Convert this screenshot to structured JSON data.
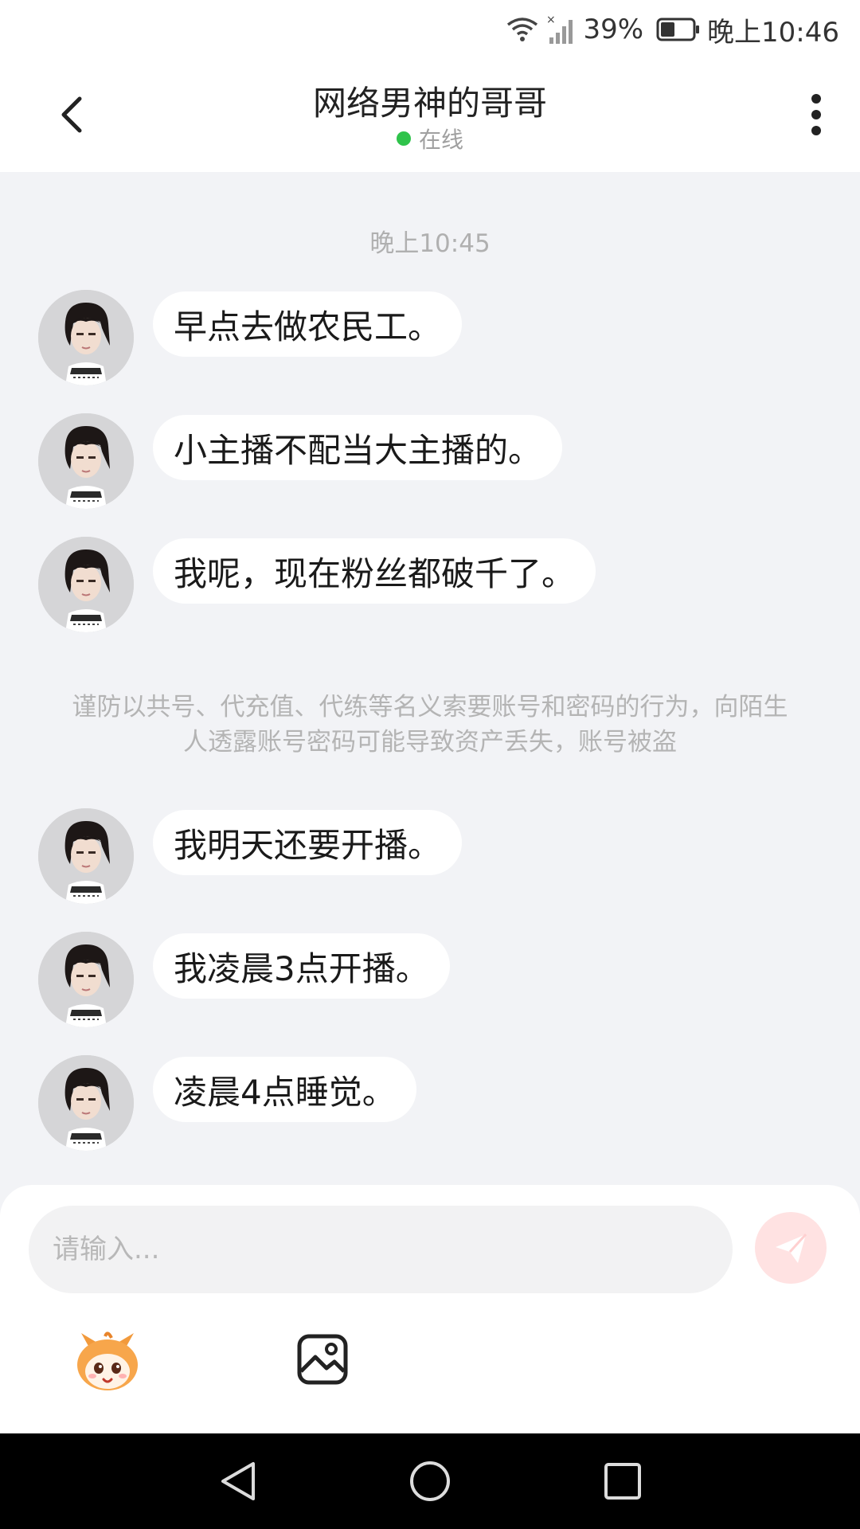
{
  "status_bar": {
    "battery_percent": "39%",
    "time": "晚上10:46"
  },
  "header": {
    "title": "网络男神的哥哥",
    "status": "在线",
    "status_color": "#2fc34b"
  },
  "chat": {
    "timestamp": "晚上10:45",
    "messages_before_notice": [
      "早点去做农民工。",
      "小主播不配当大主播的。",
      "我呢，现在粉丝都破千了。"
    ],
    "notice": "谨防以共号、代充值、代练等名义索要账号和密码的行为，向陌生人透露账号密码可能导致资产丢失，账号被盗",
    "messages_after_notice": [
      "我明天还要开播。",
      "我凌晨3点开播。",
      "凌晨4点睡觉。"
    ]
  },
  "input": {
    "placeholder": "请输入...",
    "value": ""
  },
  "icons": {
    "back": "chevron-left-icon",
    "more": "more-vertical-icon",
    "send": "paper-plane-icon",
    "mascot": "mascot-emoji-icon",
    "image": "image-icon",
    "nav_back": "triangle-back-icon",
    "nav_home": "circle-home-icon",
    "nav_recent": "square-recent-icon"
  },
  "colors": {
    "accent_send": "#ffc2c2",
    "online": "#2fc34b",
    "chat_background": "#f2f3f6"
  }
}
